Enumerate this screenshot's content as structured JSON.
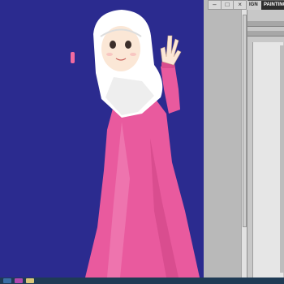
{
  "window": {
    "controls": {
      "minimize": "–",
      "restore": "□",
      "close": "×"
    }
  },
  "workspaces": [
    {
      "label": "IGN",
      "active": false
    },
    {
      "label": "PAINTING",
      "active": true
    }
  ],
  "colors": {
    "canvas_background": "#2b2b8f",
    "dress": "#e95a9e",
    "hijab": "#ffffff",
    "skin": "#fbe7d6",
    "pasteboard": "#b9b9b9"
  },
  "canvas": {
    "subject": "girl-in-hijab-waving"
  },
  "taskbar": {
    "items": [
      {
        "icon": "start-icon",
        "color": "#3b6ea5"
      },
      {
        "icon": "photoshop-icon",
        "color": "#b047b0"
      },
      {
        "icon": "folder-icon",
        "color": "#d9c77a"
      }
    ]
  }
}
